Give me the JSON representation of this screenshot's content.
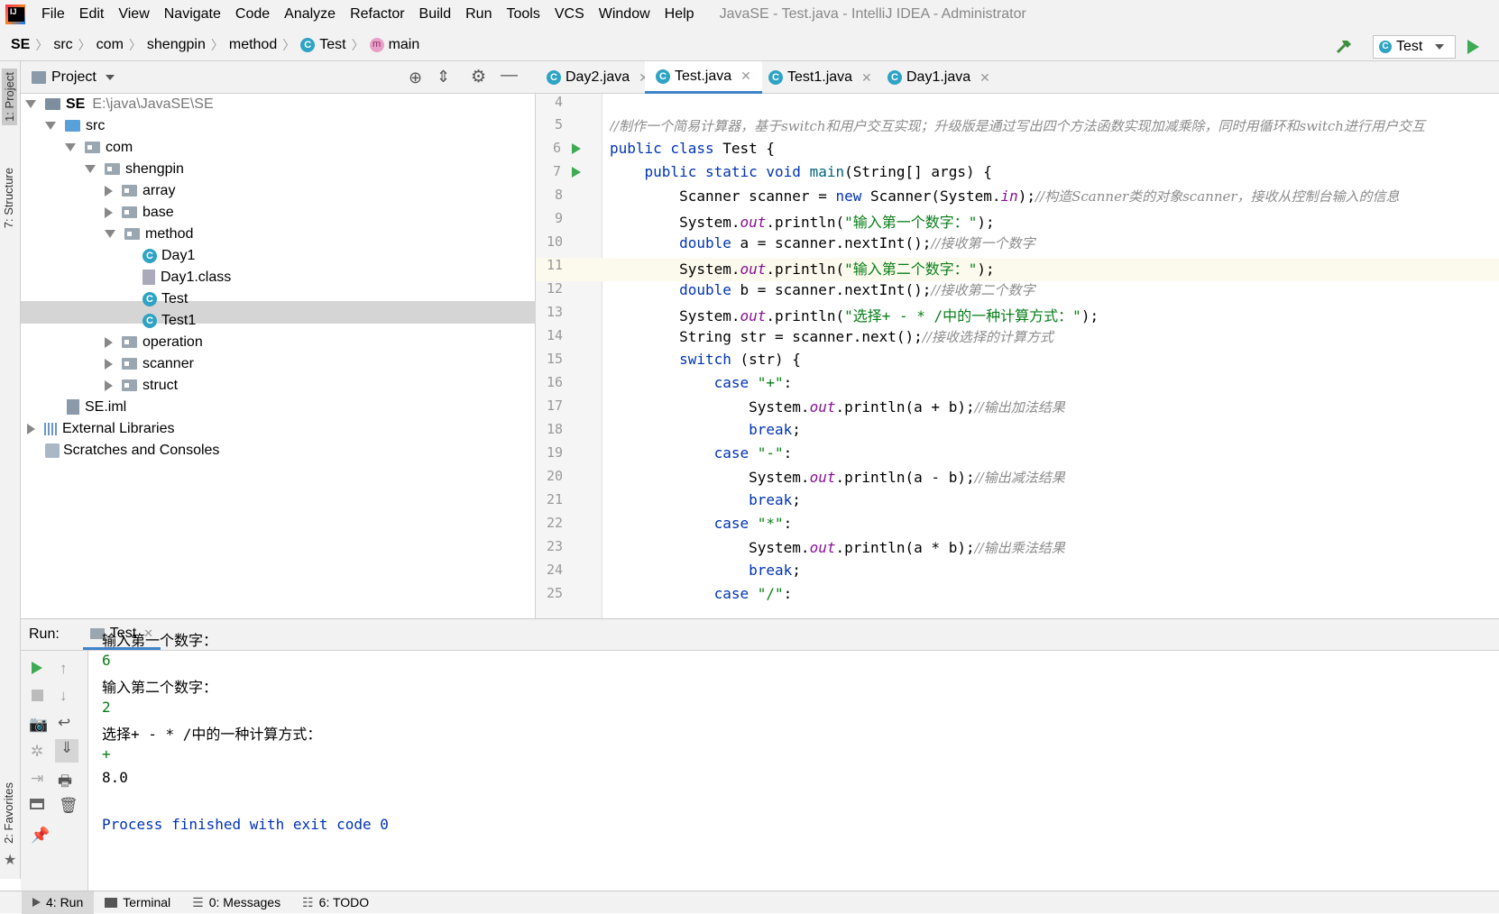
{
  "menubar": {
    "items": [
      "File",
      "Edit",
      "View",
      "Navigate",
      "Code",
      "Analyze",
      "Refactor",
      "Build",
      "Run",
      "Tools",
      "VCS",
      "Window",
      "Help"
    ],
    "window_title": "JavaSE - Test.java - IntelliJ IDEA - Administrator"
  },
  "navbar": {
    "crumbs": [
      "SE",
      "src",
      "com",
      "shengpin",
      "method",
      "Test",
      "main"
    ],
    "run_config": "Test"
  },
  "left_strip": {
    "project_tab": "1: Project",
    "structure_tab": "7: Structure",
    "favorites_tab": "2: Favorites"
  },
  "project": {
    "header": "Project",
    "root_name": "SE",
    "root_path": "E:\\java\\JavaSE\\SE",
    "nodes": [
      "src",
      "com",
      "shengpin",
      "array",
      "base",
      "method",
      "Day1",
      "Day1.class",
      "Test",
      "Test1",
      "operation",
      "scanner",
      "struct",
      "SE.iml",
      "External Libraries",
      "Scratches and Consoles"
    ]
  },
  "editor": {
    "tabs": [
      "Day2.java",
      "Test.java",
      "Test1.java",
      "Day1.java"
    ],
    "active_tab": "Test.java",
    "line_numbers": [
      "4",
      "5",
      "6",
      "7",
      "8",
      "9",
      "10",
      "11",
      "12",
      "13",
      "14",
      "15",
      "16",
      "17",
      "18",
      "19",
      "20",
      "21",
      "22",
      "23",
      "24",
      "25"
    ],
    "code": {
      "l5": "//制作一个简易计算器，基于switch和用户交互实现；升级版是通过写出四个方法函数实现加减乘除，同时用循环和switch进行用户交互",
      "l6a": "public class ",
      "l6b": "Test {",
      "l7a": "    public static void ",
      "l7b": "main",
      "l7c": "(String[] args) {",
      "l8a": "        Scanner scanner = ",
      "l8b": "new ",
      "l8c": "Scanner(System.",
      "l8d": "in",
      "l8e": ");",
      "l8f": "//构造Scanner类的对象scanner，接收从控制台输入的信息",
      "l9a": "        System.",
      "l9b": "out",
      "l9c": ".println(",
      "l9d": "\"输入第一个数字：\"",
      "l9e": ");",
      "l10a": "        ",
      "l10b": "double ",
      "l10c": "a = scanner.nextInt();",
      "l10d": "//接收第一个数字",
      "l11a": "        System.",
      "l11b": "out",
      "l11c": ".println(",
      "l11d": "\"输入第二个数字：\"",
      "l11e": ");",
      "l12a": "        ",
      "l12b": "double ",
      "l12c": "b = scanner.nextInt();",
      "l12d": "//接收第二个数字",
      "l13a": "        System.",
      "l13b": "out",
      "l13c": ".println(",
      "l13d": "\"选择+ - * /中的一种计算方式：\"",
      "l13e": ");",
      "l14a": "        String str = scanner.next();",
      "l14b": "//接收选择的计算方式",
      "l15a": "        ",
      "l15b": "switch ",
      "l15c": "(str) {",
      "l16a": "            ",
      "l16b": "case ",
      "l16c": "\"+\"",
      "l16d": ":",
      "l17a": "                System.",
      "l17b": "out",
      "l17c": ".println(a + b);",
      "l17d": "//输出加法结果",
      "l18a": "                ",
      "l18b": "break",
      ";": ";",
      "l18c": ";",
      "l19a": "            ",
      "l19b": "case ",
      "l19c": "\"-\"",
      "l19d": ":",
      "l20a": "                System.",
      "l20b": "out",
      "l20c": ".println(a - b);",
      "l20d": "//输出减法结果",
      "l21a": "                ",
      "l21b": "break",
      "l21c": ";",
      "l22a": "            ",
      "l22b": "case ",
      "l22c": "\"*\"",
      "l22d": ":",
      "l23a": "                System.",
      "l23b": "out",
      "l23c": ".println(a * b);",
      "l23d": "//输出乘法结果",
      "l24a": "                ",
      "l24b": "break",
      "l24c": ";",
      "l25a": "            ",
      "l25b": "case ",
      "l25c": "\"/\"",
      "l25d": ":"
    }
  },
  "run": {
    "label": "Run:",
    "tab": "Test",
    "output": {
      "o1": "输入第一个数字：",
      "o2": "6",
      "o3": "输入第二个数字：",
      "o4": "2",
      "o5": "选择+ - * /中的一种计算方式：",
      "o6": "+",
      "o7": "8.0",
      "o8": "Process finished with exit code 0"
    }
  },
  "bottombar": {
    "run": "4: Run",
    "terminal": "Terminal",
    "messages": "0: Messages",
    "todo": "6: TODO"
  },
  "colors": {
    "keyword": "#0033b3",
    "string": "#067d17",
    "comment": "#8c8c8c",
    "field": "#871094",
    "run_green": "#3daa54"
  }
}
